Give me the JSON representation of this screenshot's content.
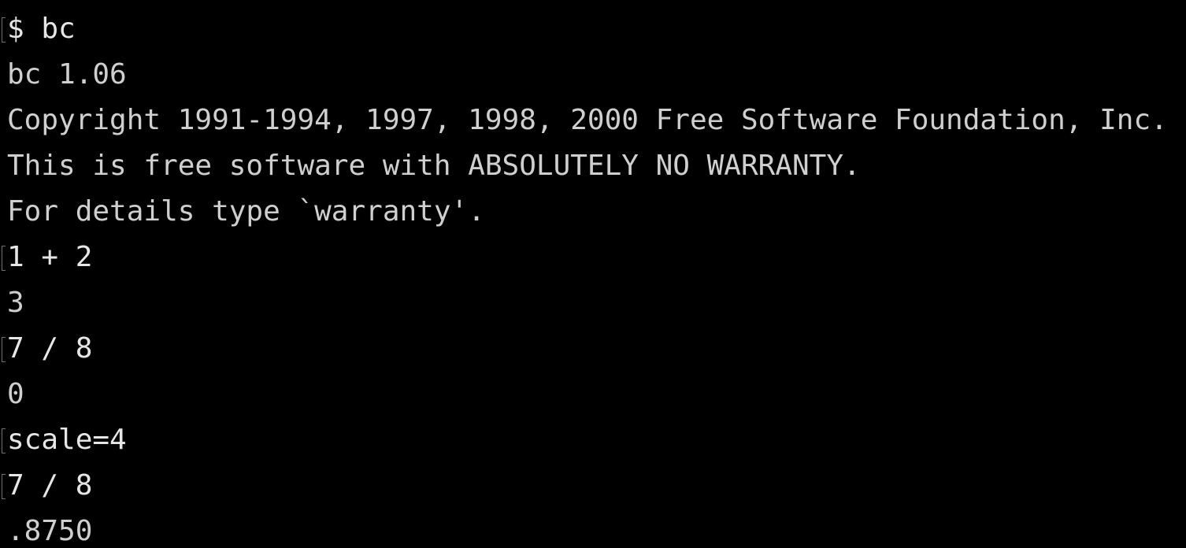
{
  "terminal": {
    "background": "#000000",
    "text_color": "#cfcfcf",
    "lines": [
      {
        "text": "$ bc",
        "type": "input"
      },
      {
        "text": "bc 1.06",
        "type": "output"
      },
      {
        "text": "Copyright 1991-1994, 1997, 1998, 2000 Free Software Foundation, Inc.",
        "type": "output"
      },
      {
        "text": "This is free software with ABSOLUTELY NO WARRANTY.",
        "type": "output"
      },
      {
        "text": "For details type `warranty'.",
        "type": "output"
      },
      {
        "text": "1 + 2",
        "type": "input"
      },
      {
        "text": "3",
        "type": "output"
      },
      {
        "text": "7 / 8",
        "type": "input"
      },
      {
        "text": "0",
        "type": "output"
      },
      {
        "text": "scale=4",
        "type": "input"
      },
      {
        "text": "7 / 8",
        "type": "input"
      },
      {
        "text": ".8750",
        "type": "output"
      }
    ]
  }
}
